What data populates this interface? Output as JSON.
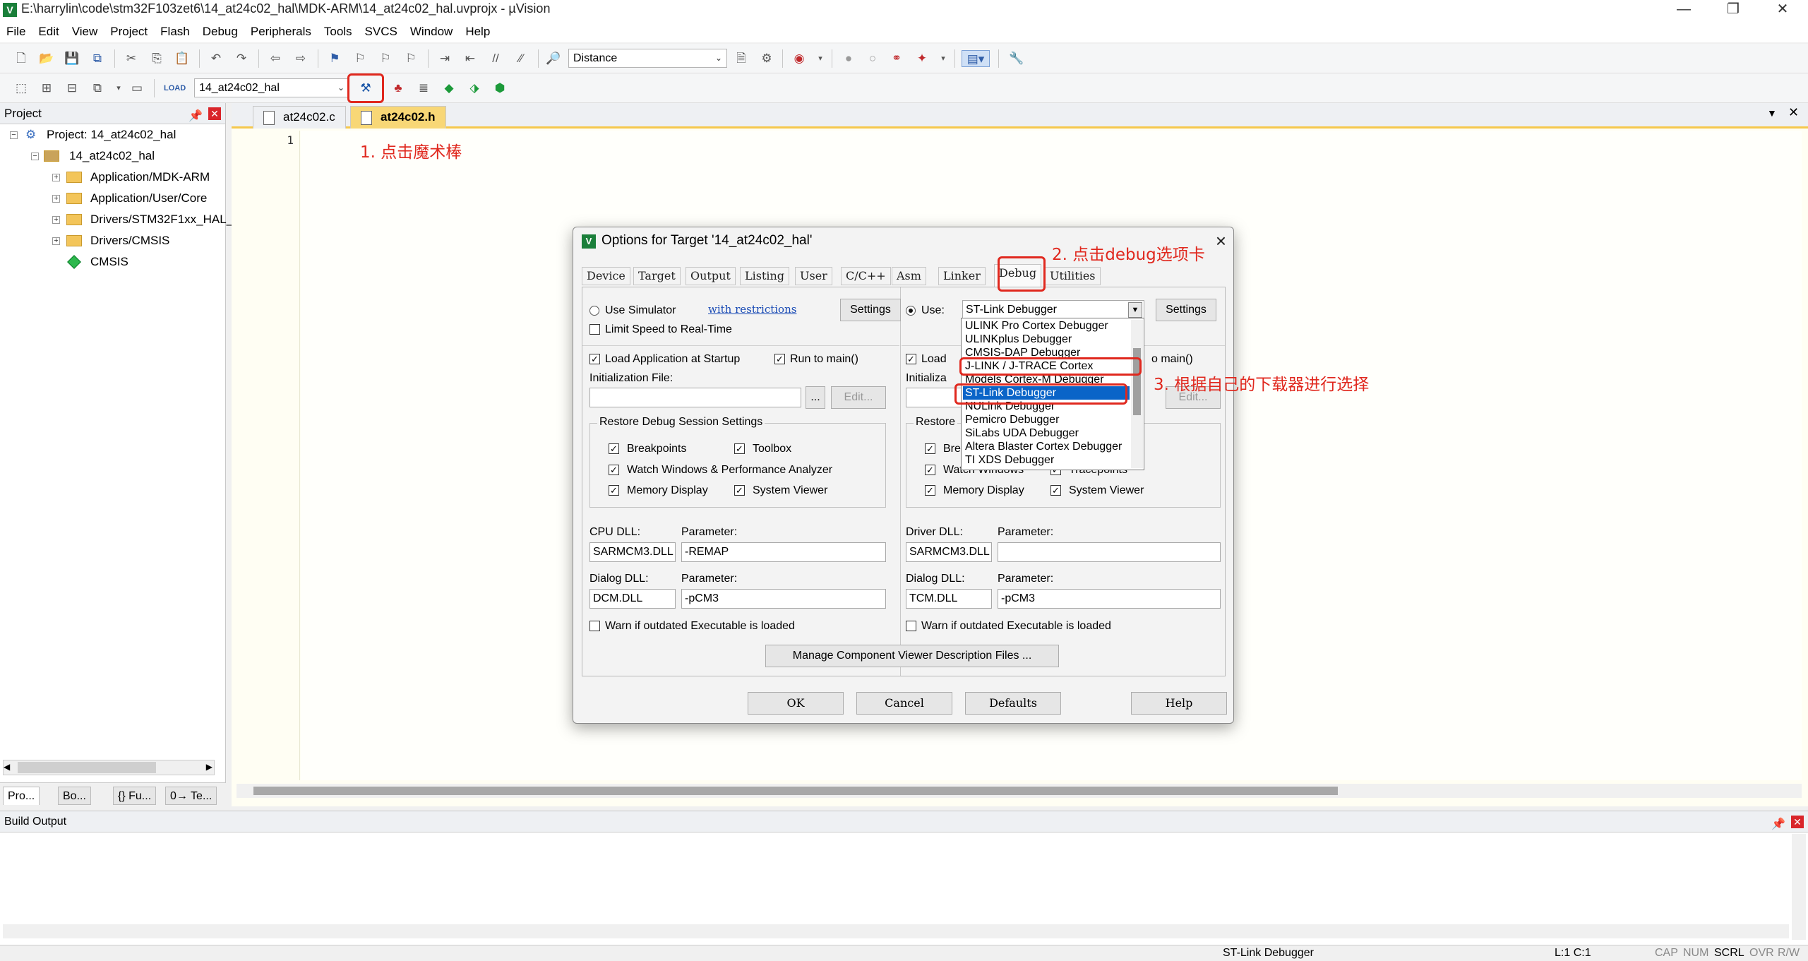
{
  "window": {
    "title": "E:\\harrylin\\code\\stm32F103zet6\\14_at24c02_hal\\MDK-ARM\\14_at24c02_hal.uvprojx - µVision",
    "app_icon": "V",
    "minimize": "—",
    "restore": "❐",
    "close": "✕"
  },
  "menu": [
    "File",
    "Edit",
    "View",
    "Project",
    "Flash",
    "Debug",
    "Peripherals",
    "Tools",
    "SVCS",
    "Window",
    "Help"
  ],
  "toolbar1": {
    "find_combo": "Distance"
  },
  "toolbar2": {
    "target_combo": "14_at24c02_hal"
  },
  "project_panel": {
    "title": "Project",
    "tree": [
      {
        "label": "Project: 14_at24c02_hal"
      },
      {
        "label": "14_at24c02_hal"
      },
      {
        "label": "Application/MDK-ARM"
      },
      {
        "label": "Application/User/Core"
      },
      {
        "label": "Drivers/STM32F1xx_HAL_"
      },
      {
        "label": "Drivers/CMSIS"
      },
      {
        "label": "CMSIS"
      }
    ],
    "bottom_tabs": [
      "Pro...",
      "Bo...",
      "{} Fu...",
      "0→ Te..."
    ]
  },
  "editor": {
    "tabs": [
      {
        "label": "at24c02.c",
        "active": false
      },
      {
        "label": "at24c02.h",
        "active": true
      }
    ],
    "line_number": "1"
  },
  "annotations": {
    "step1": "1. 点击魔术棒",
    "step2": "2. 点击debug选项卡",
    "step3": "3. 根据自己的下载器进行选择"
  },
  "dialog": {
    "title": "Options for Target '14_at24c02_hal'",
    "tabs": [
      "Device",
      "Target",
      "Output",
      "Listing",
      "User",
      "C/C++",
      "Asm",
      "Linker",
      "Debug",
      "Utilities"
    ],
    "selected_tab": "Debug",
    "left": {
      "use_simulator": "Use Simulator",
      "with_restrictions": "with restrictions",
      "settings": "Settings",
      "limit_speed": "Limit Speed to Real-Time",
      "load_app": "Load Application at Startup",
      "run_to_main": "Run to main()",
      "init_file": "Initialization File:",
      "browse": "...",
      "edit": "Edit...",
      "restore_group": "Restore Debug Session Settings",
      "breakpoints": "Breakpoints",
      "toolbox": "Toolbox",
      "watch_windows": "Watch Windows & Performance Analyzer",
      "memory_display": "Memory Display",
      "system_viewer": "System Viewer",
      "cpu_dll_label": "CPU DLL:",
      "parameter_label": "Parameter:",
      "cpu_dll": "SARMCM3.DLL",
      "cpu_param": "-REMAP",
      "dialog_dll_label": "Dialog DLL:",
      "dialog_dll": "DCM.DLL",
      "dialog_param": "-pCM3",
      "warn": "Warn if outdated Executable is loaded"
    },
    "right": {
      "use": "Use:",
      "debugger": "ST-Link Debugger",
      "settings": "Settings",
      "load_partial": "Load",
      "run_main_partial": "o main()",
      "init_partial": "Initializa",
      "edit": "Edit...",
      "restore_partial": "Restore",
      "bre_partial": "Bre",
      "watch_windows": "Watch Windows",
      "tracepoints": "Tracepoints",
      "memory_display": "Memory Display",
      "system_viewer": "System Viewer",
      "driver_dll_label": "Driver DLL:",
      "parameter_label": "Parameter:",
      "driver_dll": "SARMCM3.DLL",
      "driver_param": "",
      "dialog_dll_label": "Dialog DLL:",
      "dialog_dll": "TCM.DLL",
      "dialog_param": "-pCM3",
      "warn": "Warn if outdated Executable is loaded"
    },
    "manage_button": "Manage Component Viewer Description Files ...",
    "ok": "OK",
    "cancel": "Cancel",
    "defaults": "Defaults",
    "help": "Help",
    "dropdown_options": [
      "ULINK Pro Cortex Debugger",
      "ULINKplus Debugger",
      "CMSIS-DAP Debugger",
      "J-LINK / J-TRACE Cortex",
      "Models Cortex-M Debugger",
      "ST-Link Debugger",
      "NULink Debugger",
      "Pemicro Debugger",
      "SiLabs UDA Debugger",
      "Altera Blaster Cortex Debugger",
      "TI XDS Debugger"
    ],
    "dropdown_selected": "ST-Link Debugger"
  },
  "build_output": {
    "title": "Build Output"
  },
  "statusbar": {
    "debugger": "ST-Link Debugger",
    "position": "L:1 C:1",
    "caps": "CAP",
    "num": "NUM",
    "scrl": "SCRL",
    "ovr": "OVR",
    "rw": "R/W"
  },
  "colors": {
    "annotation": "#e0281e",
    "selection": "#0a64c8",
    "active_tab": "#f8d776"
  }
}
